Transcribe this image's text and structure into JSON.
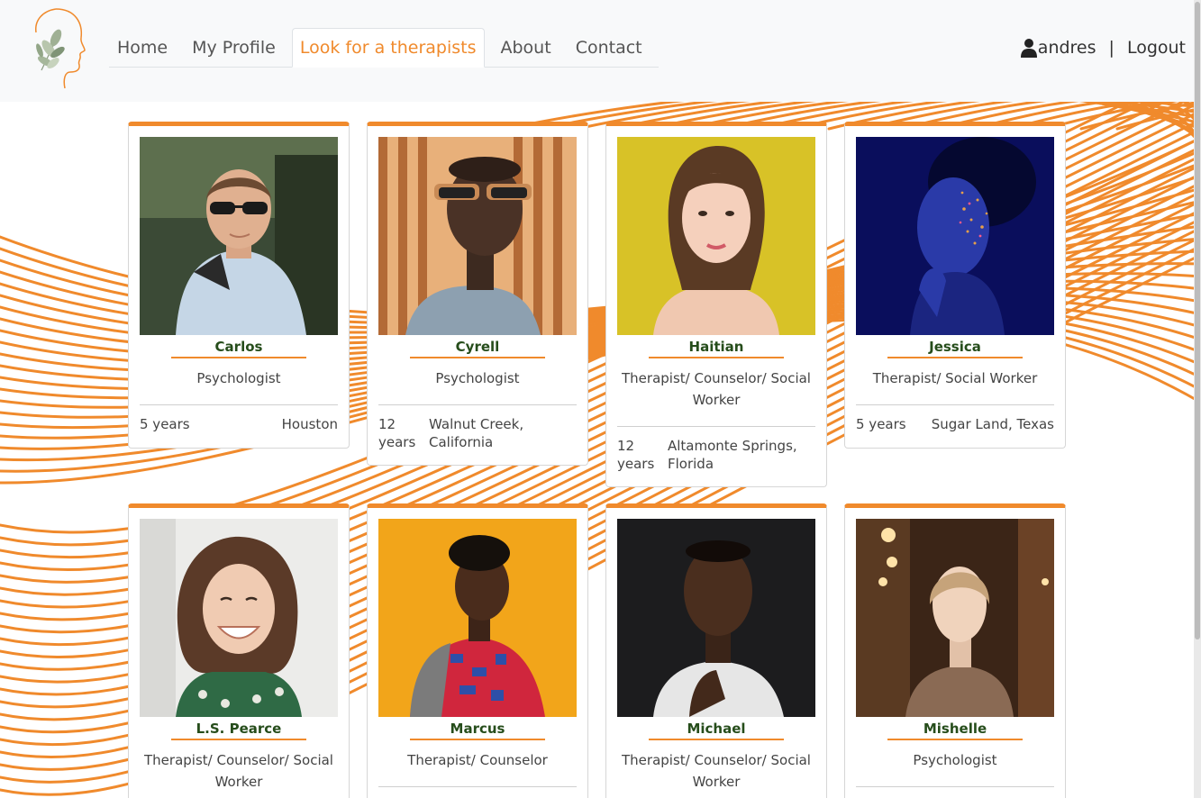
{
  "nav": {
    "items": [
      {
        "label": "Home",
        "active": false
      },
      {
        "label": "My Profile",
        "active": false
      },
      {
        "label": "Look for a therapists",
        "active": true
      },
      {
        "label": "About",
        "active": false
      },
      {
        "label": "Contact",
        "active": false
      }
    ],
    "username": "andres",
    "separator": "|",
    "logout": "Logout"
  },
  "colors": {
    "accent": "#f08a2c",
    "name_text": "#264d1b",
    "header_bg": "#f8f9fa"
  },
  "therapists": [
    {
      "name": "Carlos",
      "role": "Psychologist",
      "experience": "5 years",
      "location": "Houston",
      "photo_icon": "portrait-man-sunglasses"
    },
    {
      "name": "Cyrell",
      "role": "Psychologist",
      "experience": "12 years",
      "location": "Walnut Creek, California",
      "photo_icon": "portrait-man-sunglasses-profile"
    },
    {
      "name": "Haitian",
      "role": "Therapist/ Counselor/ Social Worker",
      "experience": "12 years",
      "location": "Altamonte Springs, Florida",
      "photo_icon": "portrait-woman-yellow-bg"
    },
    {
      "name": "Jessica",
      "role": "Therapist/ Social Worker",
      "experience": "5 years",
      "location": "Sugar Land, Texas",
      "photo_icon": "portrait-woman-blue-glitter"
    },
    {
      "name": "L.S. Pearce",
      "role": "Therapist/ Counselor/ Social Worker",
      "experience": "",
      "location": "",
      "photo_icon": "portrait-woman-smiling"
    },
    {
      "name": "Marcus",
      "role": "Therapist/ Counselor",
      "experience": "",
      "location": "",
      "photo_icon": "portrait-man-orange-bg"
    },
    {
      "name": "Michael",
      "role": "Therapist/ Counselor/ Social Worker",
      "experience": "",
      "location": "",
      "photo_icon": "portrait-man-dark-bg"
    },
    {
      "name": "Mishelle",
      "role": "Psychologist",
      "experience": "",
      "location": "",
      "photo_icon": "portrait-woman-warm-light"
    }
  ]
}
